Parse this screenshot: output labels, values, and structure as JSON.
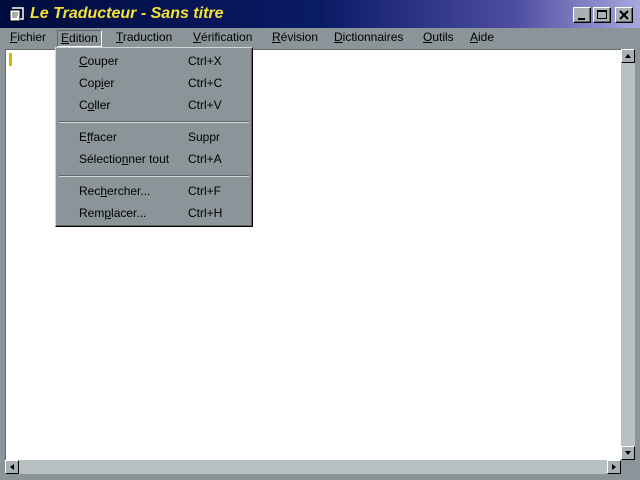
{
  "window": {
    "title": "Le Traducteur - Sans titre",
    "icon": "app-document-icon",
    "controls": [
      "minimize-icon",
      "maximize-icon",
      "close-icon"
    ],
    "title_color": "#f4e23a"
  },
  "menubar": {
    "items": [
      {
        "key": "fichier",
        "pre": "",
        "u": "F",
        "post": "ichier"
      },
      {
        "key": "edition",
        "pre": "",
        "u": "E",
        "post": "dition",
        "active": true
      },
      {
        "key": "traduction",
        "pre": "",
        "u": "T",
        "post": "raduction"
      },
      {
        "key": "verification",
        "pre": "",
        "u": "V",
        "post": "érification"
      },
      {
        "key": "revision",
        "pre": "",
        "u": "R",
        "post": "évision"
      },
      {
        "key": "dictionnaires",
        "pre": "",
        "u": "D",
        "post": "ictionnaires"
      },
      {
        "key": "outils",
        "pre": "",
        "u": "O",
        "post": "utils"
      },
      {
        "key": "aide",
        "pre": "",
        "u": "A",
        "post": "ide"
      }
    ]
  },
  "edition_menu": {
    "groups": [
      [
        {
          "key": "couper",
          "pre": "",
          "u": "C",
          "post": "ouper",
          "shortcut": "Ctrl+X"
        },
        {
          "key": "copier",
          "pre": "Cop",
          "u": "i",
          "post": "er",
          "shortcut": "Ctrl+C"
        },
        {
          "key": "coller",
          "pre": "C",
          "u": "o",
          "post": "ller",
          "shortcut": "Ctrl+V"
        }
      ],
      [
        {
          "key": "effacer",
          "pre": "E",
          "u": "f",
          "post": "facer",
          "shortcut": "Suppr"
        },
        {
          "key": "selectionner-tout",
          "pre": "Sélectio",
          "u": "n",
          "post": "ner tout",
          "shortcut": "Ctrl+A"
        }
      ],
      [
        {
          "key": "rechercher",
          "pre": "Rec",
          "u": "h",
          "post": "ercher...",
          "shortcut": "Ctrl+F"
        },
        {
          "key": "remplacer",
          "pre": "Rem",
          "u": "p",
          "post": "lacer...",
          "shortcut": "Ctrl+H"
        }
      ]
    ]
  },
  "editor": {
    "text": "",
    "caret_color": "#d8b800"
  },
  "scrollbars": {
    "vertical": {
      "up": "arrow-up-icon",
      "down": "arrow-down-icon"
    },
    "horizontal": {
      "left": "arrow-left-icon",
      "right": "arrow-right-icon"
    }
  }
}
